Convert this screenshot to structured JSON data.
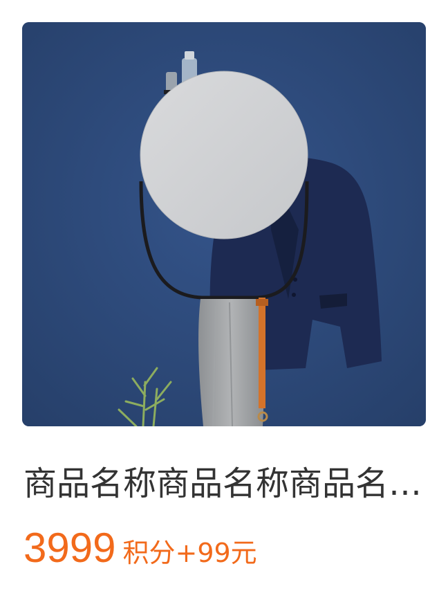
{
  "product": {
    "image_label": "Wall mirror with round glass, black oval frame, navy suit jacket, grey scarf, orange belt",
    "title": "商品名称商品名称商品名称商品名称",
    "price": "3999",
    "points_text": "积分+99元"
  },
  "colors": {
    "price": "#f26a1b",
    "title": "#333333",
    "image_bg": "#2e4a7a"
  }
}
